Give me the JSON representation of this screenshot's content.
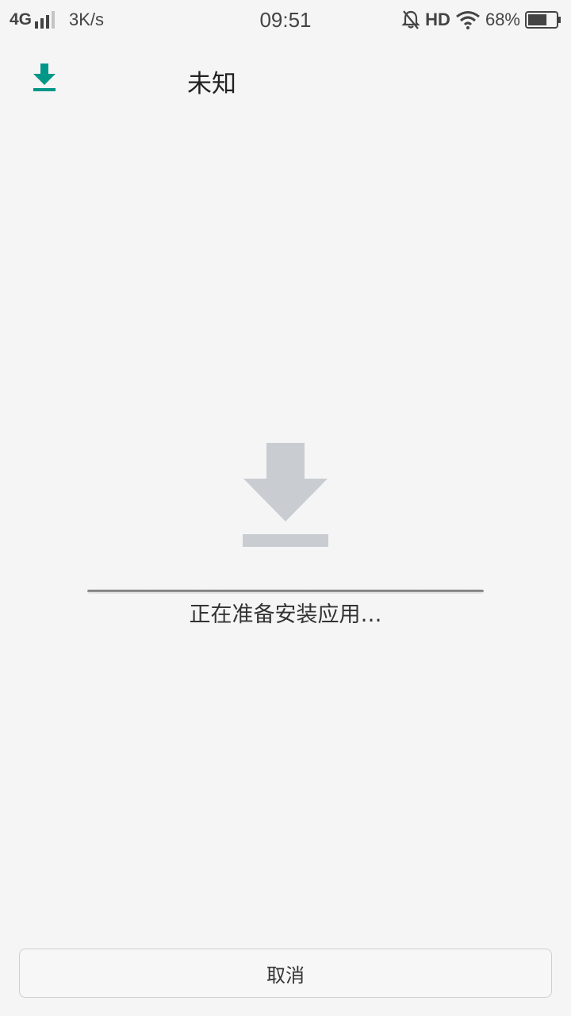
{
  "status_bar": {
    "network": "4G",
    "speed": "3K/s",
    "time": "09:51",
    "hd": "HD",
    "battery": "68%",
    "battery_level": 0.68,
    "icons": [
      "signal-icon",
      "bell-off-icon",
      "wifi-icon",
      "battery-icon"
    ]
  },
  "header": {
    "title": "未知",
    "icon": "download-icon",
    "icon_color": "#009688"
  },
  "install": {
    "status": "正在准备安装应用…",
    "progress": 1.0,
    "icon": "download-icon",
    "icon_color": "#c9ccd0"
  },
  "actions": {
    "cancel_label": "取消"
  }
}
